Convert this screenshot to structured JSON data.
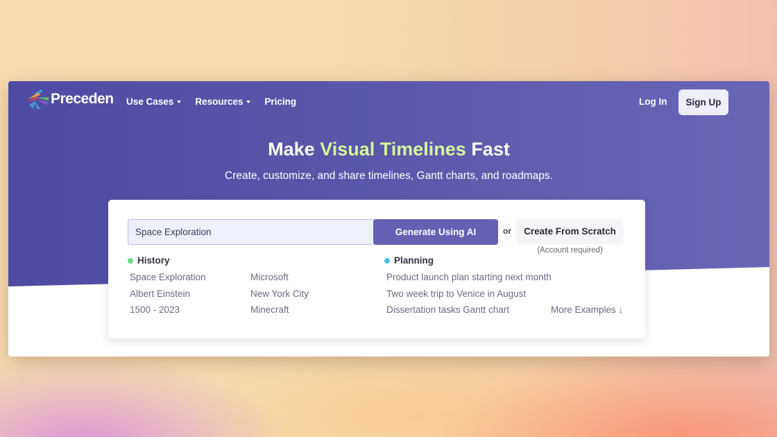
{
  "nav": {
    "brand": "Preceden",
    "links": [
      {
        "label": "Use Cases",
        "dropdown": true
      },
      {
        "label": "Resources",
        "dropdown": true
      },
      {
        "label": "Pricing",
        "dropdown": false
      }
    ],
    "login_label": "Log In",
    "signup_label": "Sign Up"
  },
  "hero": {
    "headline_pre": "Make ",
    "headline_accent": "Visual Timelines",
    "headline_post": " Fast",
    "subhead": "Create, customize, and share timelines, Gantt charts, and roadmaps."
  },
  "generator": {
    "input_value": "Space Exploration",
    "generate_label": "Generate Using AI",
    "or_label": "or",
    "scratch_label": "Create From Scratch",
    "account_note": "(Account required)"
  },
  "examples": {
    "history": {
      "title": "History",
      "col1": [
        "Space Exploration",
        "Albert Einstein",
        "1500 - 2023"
      ],
      "col2": [
        "Microsoft",
        "New York City",
        "Minecraft"
      ]
    },
    "planning": {
      "title": "Planning",
      "items": [
        "Product launch plan starting next month",
        "Two week trip to Venice in August",
        "Dissertation tasks Gantt chart"
      ]
    },
    "more_label": "More Examples ↓"
  },
  "colors": {
    "hero_purple": "#5a57aa",
    "accent_green": "#d9f49b",
    "generate_button": "#6560b4",
    "history_dot": "#6fdc8c",
    "planning_dot": "#3fc6ea"
  }
}
